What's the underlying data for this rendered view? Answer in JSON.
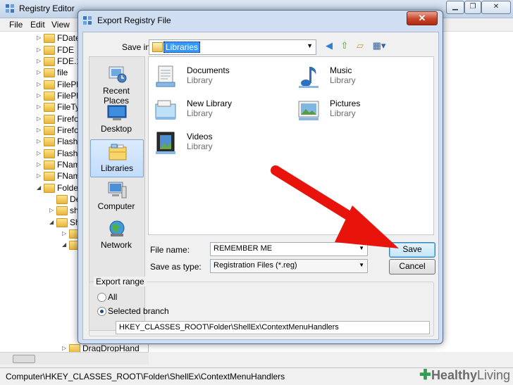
{
  "regedit": {
    "title": "Registry Editor",
    "menu": [
      "File",
      "Edit",
      "View"
    ],
    "tree_items": [
      "FDate",
      "FDE",
      "FDE.1",
      "file",
      "FilePla",
      "FilePla",
      "FileTy",
      "Firefo",
      "Firefo",
      "Flashl",
      "Flashl",
      "FNam",
      "FNam",
      "Folde",
      "De",
      "sh",
      "Sh",
      "",
      "",
      "DragDropHand"
    ],
    "status_path": "Computer\\HKEY_CLASSES_ROOT\\Folder\\ShellEx\\ContextMenuHandlers"
  },
  "dialog": {
    "title": "Export Registry File",
    "save_in_label": "Save in:",
    "save_in_value": "Libraries",
    "places": [
      "Recent Places",
      "Desktop",
      "Libraries",
      "Computer",
      "Network"
    ],
    "selected_place": "Libraries",
    "files": [
      {
        "name": "Documents",
        "type": "Library",
        "icon": "documents-library-icon"
      },
      {
        "name": "Music",
        "type": "Library",
        "icon": "music-library-icon"
      },
      {
        "name": "New Library",
        "type": "Library",
        "icon": "new-library-icon"
      },
      {
        "name": "Pictures",
        "type": "Library",
        "icon": "pictures-library-icon"
      },
      {
        "name": "Videos",
        "type": "Library",
        "icon": "videos-library-icon"
      }
    ],
    "file_name_label": "File name:",
    "file_name_value": "REMEMBER ME",
    "save_as_type_label": "Save as type:",
    "save_as_type_value": "Registration Files (*.reg)",
    "save_button": "Save",
    "cancel_button": "Cancel",
    "export_range": {
      "legend": "Export range",
      "all_label": "All",
      "selected_branch_label": "Selected branch",
      "selected": "Selected branch",
      "branch_value": "HKEY_CLASSES_ROOT\\Folder\\ShellEx\\ContextMenuHandlers"
    }
  },
  "watermark": {
    "part1": "Healthy",
    "part2": "Living"
  },
  "colors": {
    "annotation_arrow": "#e8140c",
    "selection": "#3399ff",
    "close_button": "#c8452a"
  }
}
